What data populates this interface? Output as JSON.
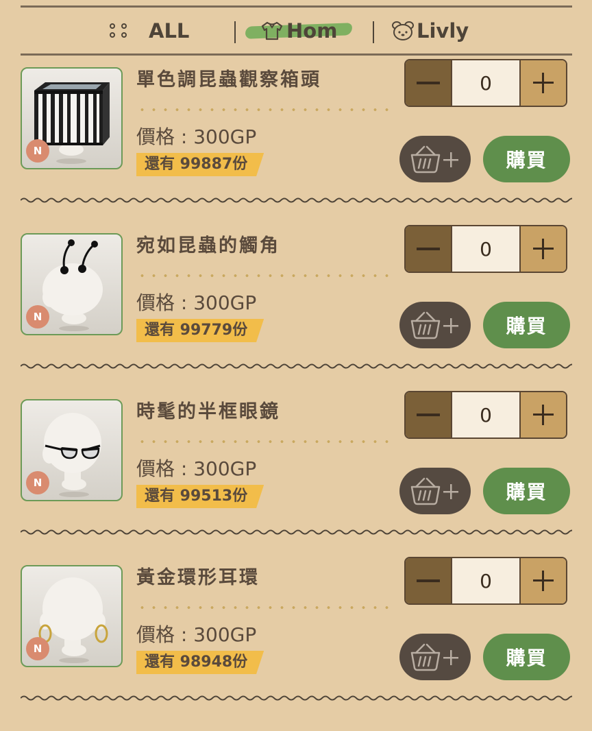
{
  "tabs": [
    {
      "label": "ALL",
      "icon": "grid-dots-icon"
    },
    {
      "label": "Hom",
      "icon": "shirt-icon",
      "active": true
    },
    {
      "label": "Livly",
      "icon": "livly-face-icon"
    }
  ],
  "colors": {
    "background": "#e5cca5",
    "buy_button": "#5f8f4c",
    "stock_tag": "#f2bd4a",
    "active_tab_highlight": "#7fb061"
  },
  "items": [
    {
      "name": "單色調昆蟲觀察箱頭",
      "price": "價格 : 300GP",
      "stock": "還有 99887份",
      "badge": "N",
      "qty": "0",
      "buy": "購買",
      "image": "insect-cage-head-icon"
    },
    {
      "name": "宛如昆蟲的觸角",
      "price": "價格 : 300GP",
      "stock": "還有 99779份",
      "badge": "N",
      "qty": "0",
      "buy": "購買",
      "image": "insect-antenna-icon"
    },
    {
      "name": "時髦的半框眼鏡",
      "price": "價格 : 300GP",
      "stock": "還有 99513份",
      "badge": "N",
      "qty": "0",
      "buy": "購買",
      "image": "half-frame-glasses-icon"
    },
    {
      "name": "黃金環形耳環",
      "price": "價格 : 300GP",
      "stock": "還有 98948份",
      "badge": "N",
      "qty": "0",
      "buy": "購買",
      "image": "gold-hoop-earrings-icon"
    }
  ]
}
